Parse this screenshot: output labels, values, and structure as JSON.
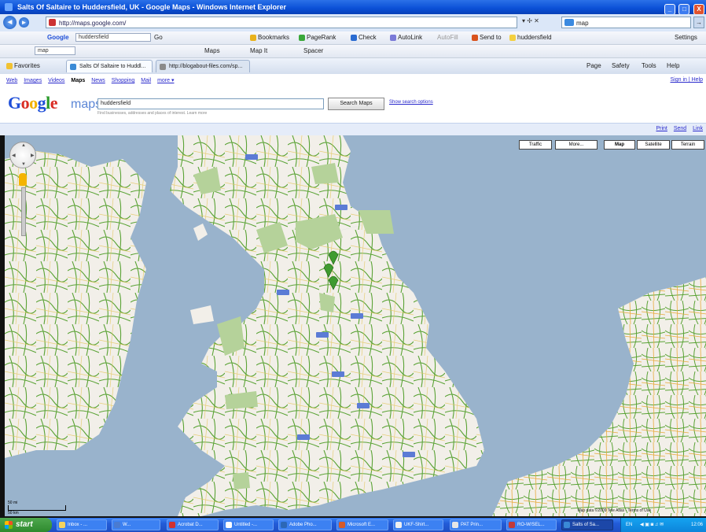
{
  "window": {
    "title": "Salts Of Saltaire to Huddersfield, UK - Google Maps - Windows Internet Explorer",
    "buttons": [
      "_",
      "□",
      "X"
    ]
  },
  "addressbar": {
    "url": "http://maps.google.com/",
    "live_search_value": "map",
    "go_label": "→"
  },
  "google_toolbar": {
    "search_value": "huddersfield",
    "items": [
      "Google",
      "Go",
      "Bookmarks",
      "PageRank",
      "Check",
      "AutoLink",
      "AutoFill",
      "Send to",
      "huddersfield",
      "Settings"
    ]
  },
  "links_toolbar": {
    "items": [
      "map",
      "Maps",
      "Map It",
      "Spacer"
    ]
  },
  "tabs_bar": {
    "favorites_label": "Favorites",
    "tabs": [
      "Salts Of Saltaire to Huddl...",
      "http://blogabout-files.com/sp..."
    ],
    "right_tools": [
      "Page",
      "Safety",
      "Tools",
      "Help"
    ]
  },
  "gmaps": {
    "nav": [
      {
        "label": "Web",
        "active": false
      },
      {
        "label": "Images",
        "active": false
      },
      {
        "label": "Videos",
        "active": false
      },
      {
        "label": "Maps",
        "active": true
      },
      {
        "label": "News",
        "active": false
      },
      {
        "label": "Shopping",
        "active": false
      },
      {
        "label": "Mail",
        "active": false
      },
      {
        "label": "more ▾",
        "active": false
      }
    ],
    "signin": "Sign in | Help",
    "logo_suffix": "maps",
    "search_value": "huddersfield",
    "search_button": "Search Maps",
    "search_options": "Show search options",
    "search_hint": "Find businesses, addresses and places of interest. Learn more",
    "strip_links": [
      "Print",
      "Send",
      "Link"
    ]
  },
  "map": {
    "map_types": [
      "Traffic",
      "More...",
      "Map",
      "Satellite",
      "Terrain"
    ],
    "selected_type": "Map",
    "scale_top": "50 mi",
    "scale_bottom": "50 km",
    "copyright": "Map data ©2009 Tele Atlas - Terms of Use"
  },
  "taskbar": {
    "start_label": "start",
    "tasks": [
      {
        "label": "Inbox - ...",
        "active": false
      },
      {
        "label": "W...",
        "active": false
      },
      {
        "label": "Acrobat D...",
        "active": false
      },
      {
        "label": "Untitled -...",
        "active": false
      },
      {
        "label": "Adobe Pho...",
        "active": false
      },
      {
        "label": "Microsoft E...",
        "active": false
      },
      {
        "label": "UKF-Shirt...",
        "active": false
      },
      {
        "label": "PAT Prin...",
        "active": false
      },
      {
        "label": "RO-W/SEL...",
        "active": false
      },
      {
        "label": "Salts of Sa...",
        "active": true
      }
    ],
    "tray_lang": "EN",
    "clock": "12:06"
  },
  "colors": {
    "water": "#99b3cc",
    "land": "#f2efe9",
    "park": "#b5d29a",
    "road": "#5aa335",
    "motorway_shield": "#5b7bd5"
  }
}
